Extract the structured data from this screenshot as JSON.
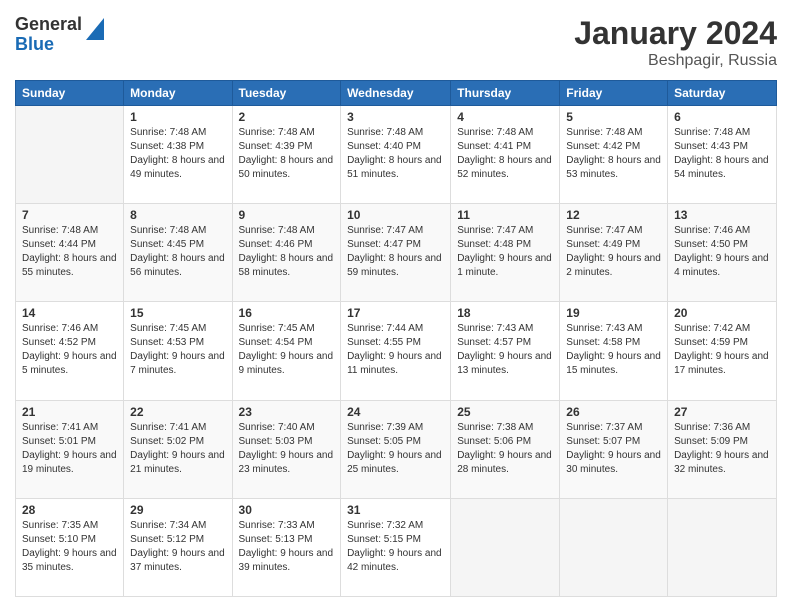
{
  "header": {
    "logo": {
      "general": "General",
      "blue": "Blue"
    },
    "title": "January 2024",
    "subtitle": "Beshpagir, Russia"
  },
  "weekdays": [
    "Sunday",
    "Monday",
    "Tuesday",
    "Wednesday",
    "Thursday",
    "Friday",
    "Saturday"
  ],
  "weeks": [
    [
      {
        "day": "",
        "sunrise": "",
        "sunset": "",
        "daylight": "",
        "empty": true
      },
      {
        "day": "1",
        "sunrise": "Sunrise: 7:48 AM",
        "sunset": "Sunset: 4:38 PM",
        "daylight": "Daylight: 8 hours and 49 minutes."
      },
      {
        "day": "2",
        "sunrise": "Sunrise: 7:48 AM",
        "sunset": "Sunset: 4:39 PM",
        "daylight": "Daylight: 8 hours and 50 minutes."
      },
      {
        "day": "3",
        "sunrise": "Sunrise: 7:48 AM",
        "sunset": "Sunset: 4:40 PM",
        "daylight": "Daylight: 8 hours and 51 minutes."
      },
      {
        "day": "4",
        "sunrise": "Sunrise: 7:48 AM",
        "sunset": "Sunset: 4:41 PM",
        "daylight": "Daylight: 8 hours and 52 minutes."
      },
      {
        "day": "5",
        "sunrise": "Sunrise: 7:48 AM",
        "sunset": "Sunset: 4:42 PM",
        "daylight": "Daylight: 8 hours and 53 minutes."
      },
      {
        "day": "6",
        "sunrise": "Sunrise: 7:48 AM",
        "sunset": "Sunset: 4:43 PM",
        "daylight": "Daylight: 8 hours and 54 minutes."
      }
    ],
    [
      {
        "day": "7",
        "sunrise": "Sunrise: 7:48 AM",
        "sunset": "Sunset: 4:44 PM",
        "daylight": "Daylight: 8 hours and 55 minutes."
      },
      {
        "day": "8",
        "sunrise": "Sunrise: 7:48 AM",
        "sunset": "Sunset: 4:45 PM",
        "daylight": "Daylight: 8 hours and 56 minutes."
      },
      {
        "day": "9",
        "sunrise": "Sunrise: 7:48 AM",
        "sunset": "Sunset: 4:46 PM",
        "daylight": "Daylight: 8 hours and 58 minutes."
      },
      {
        "day": "10",
        "sunrise": "Sunrise: 7:47 AM",
        "sunset": "Sunset: 4:47 PM",
        "daylight": "Daylight: 8 hours and 59 minutes."
      },
      {
        "day": "11",
        "sunrise": "Sunrise: 7:47 AM",
        "sunset": "Sunset: 4:48 PM",
        "daylight": "Daylight: 9 hours and 1 minute."
      },
      {
        "day": "12",
        "sunrise": "Sunrise: 7:47 AM",
        "sunset": "Sunset: 4:49 PM",
        "daylight": "Daylight: 9 hours and 2 minutes."
      },
      {
        "day": "13",
        "sunrise": "Sunrise: 7:46 AM",
        "sunset": "Sunset: 4:50 PM",
        "daylight": "Daylight: 9 hours and 4 minutes."
      }
    ],
    [
      {
        "day": "14",
        "sunrise": "Sunrise: 7:46 AM",
        "sunset": "Sunset: 4:52 PM",
        "daylight": "Daylight: 9 hours and 5 minutes."
      },
      {
        "day": "15",
        "sunrise": "Sunrise: 7:45 AM",
        "sunset": "Sunset: 4:53 PM",
        "daylight": "Daylight: 9 hours and 7 minutes."
      },
      {
        "day": "16",
        "sunrise": "Sunrise: 7:45 AM",
        "sunset": "Sunset: 4:54 PM",
        "daylight": "Daylight: 9 hours and 9 minutes."
      },
      {
        "day": "17",
        "sunrise": "Sunrise: 7:44 AM",
        "sunset": "Sunset: 4:55 PM",
        "daylight": "Daylight: 9 hours and 11 minutes."
      },
      {
        "day": "18",
        "sunrise": "Sunrise: 7:43 AM",
        "sunset": "Sunset: 4:57 PM",
        "daylight": "Daylight: 9 hours and 13 minutes."
      },
      {
        "day": "19",
        "sunrise": "Sunrise: 7:43 AM",
        "sunset": "Sunset: 4:58 PM",
        "daylight": "Daylight: 9 hours and 15 minutes."
      },
      {
        "day": "20",
        "sunrise": "Sunrise: 7:42 AM",
        "sunset": "Sunset: 4:59 PM",
        "daylight": "Daylight: 9 hours and 17 minutes."
      }
    ],
    [
      {
        "day": "21",
        "sunrise": "Sunrise: 7:41 AM",
        "sunset": "Sunset: 5:01 PM",
        "daylight": "Daylight: 9 hours and 19 minutes."
      },
      {
        "day": "22",
        "sunrise": "Sunrise: 7:41 AM",
        "sunset": "Sunset: 5:02 PM",
        "daylight": "Daylight: 9 hours and 21 minutes."
      },
      {
        "day": "23",
        "sunrise": "Sunrise: 7:40 AM",
        "sunset": "Sunset: 5:03 PM",
        "daylight": "Daylight: 9 hours and 23 minutes."
      },
      {
        "day": "24",
        "sunrise": "Sunrise: 7:39 AM",
        "sunset": "Sunset: 5:05 PM",
        "daylight": "Daylight: 9 hours and 25 minutes."
      },
      {
        "day": "25",
        "sunrise": "Sunrise: 7:38 AM",
        "sunset": "Sunset: 5:06 PM",
        "daylight": "Daylight: 9 hours and 28 minutes."
      },
      {
        "day": "26",
        "sunrise": "Sunrise: 7:37 AM",
        "sunset": "Sunset: 5:07 PM",
        "daylight": "Daylight: 9 hours and 30 minutes."
      },
      {
        "day": "27",
        "sunrise": "Sunrise: 7:36 AM",
        "sunset": "Sunset: 5:09 PM",
        "daylight": "Daylight: 9 hours and 32 minutes."
      }
    ],
    [
      {
        "day": "28",
        "sunrise": "Sunrise: 7:35 AM",
        "sunset": "Sunset: 5:10 PM",
        "daylight": "Daylight: 9 hours and 35 minutes."
      },
      {
        "day": "29",
        "sunrise": "Sunrise: 7:34 AM",
        "sunset": "Sunset: 5:12 PM",
        "daylight": "Daylight: 9 hours and 37 minutes."
      },
      {
        "day": "30",
        "sunrise": "Sunrise: 7:33 AM",
        "sunset": "Sunset: 5:13 PM",
        "daylight": "Daylight: 9 hours and 39 minutes."
      },
      {
        "day": "31",
        "sunrise": "Sunrise: 7:32 AM",
        "sunset": "Sunset: 5:15 PM",
        "daylight": "Daylight: 9 hours and 42 minutes."
      },
      {
        "day": "",
        "sunrise": "",
        "sunset": "",
        "daylight": "",
        "empty": true
      },
      {
        "day": "",
        "sunrise": "",
        "sunset": "",
        "daylight": "",
        "empty": true
      },
      {
        "day": "",
        "sunrise": "",
        "sunset": "",
        "daylight": "",
        "empty": true
      }
    ]
  ]
}
